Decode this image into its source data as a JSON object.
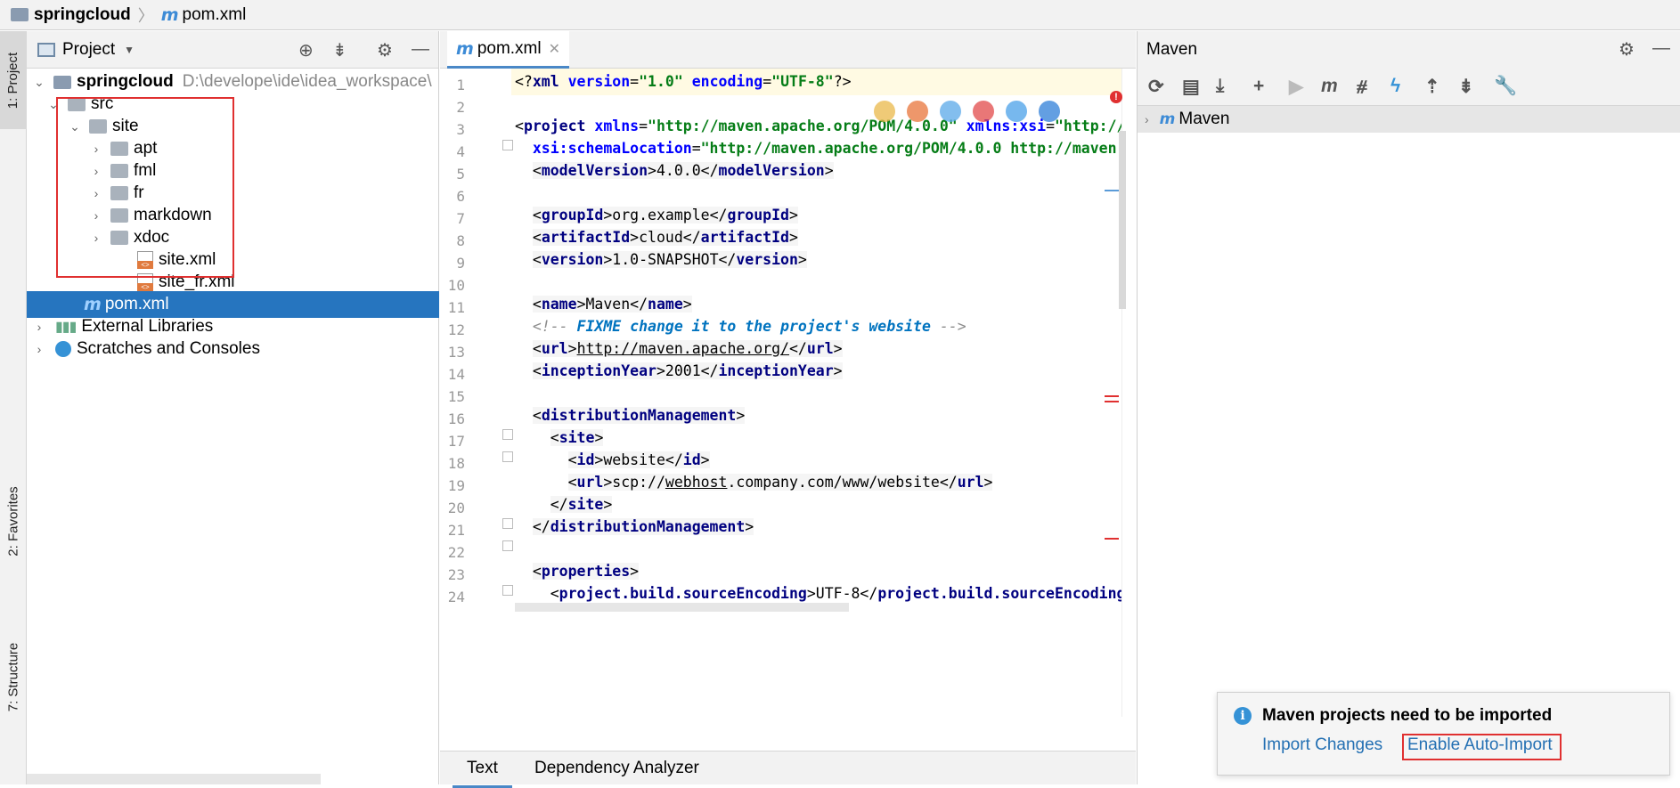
{
  "breadcrumb": {
    "project": "springcloud",
    "file": "pom.xml"
  },
  "left_stripe": {
    "tabs": [
      "1: Project",
      "2: Favorites",
      "7: Structure"
    ]
  },
  "project_panel": {
    "title": "Project",
    "tree": [
      {
        "label": "springcloud",
        "path": "D:\\develope\\ide\\idea_workspace\\"
      },
      {
        "label": "src"
      },
      {
        "label": "site"
      },
      {
        "label": "apt"
      },
      {
        "label": "fml"
      },
      {
        "label": "fr"
      },
      {
        "label": "markdown"
      },
      {
        "label": "xdoc"
      },
      {
        "label": "site.xml"
      },
      {
        "label": "site_fr.xml"
      },
      {
        "label": "pom.xml"
      },
      {
        "label": "External Libraries"
      },
      {
        "label": "Scratches and Consoles"
      }
    ]
  },
  "editor": {
    "tab_label": "pom.xml",
    "line_numbers": [
      "1",
      "2",
      "3",
      "4",
      "5",
      "6",
      "7",
      "8",
      "9",
      "10",
      "11",
      "12",
      "13",
      "14",
      "15",
      "16",
      "17",
      "18",
      "19",
      "20",
      "21",
      "22",
      "23",
      "24"
    ],
    "bottom_tabs": [
      "Text",
      "Dependency Analyzer"
    ]
  },
  "maven": {
    "title": "Maven",
    "root_item": "Maven",
    "notification": {
      "title": "Maven projects need to be imported",
      "import_changes": "Import Changes",
      "enable_auto_import": "Enable Auto-Import"
    }
  },
  "colors": {
    "selection": "#2675bf",
    "highlight_box": "#e03030",
    "link": "#2470b3"
  }
}
